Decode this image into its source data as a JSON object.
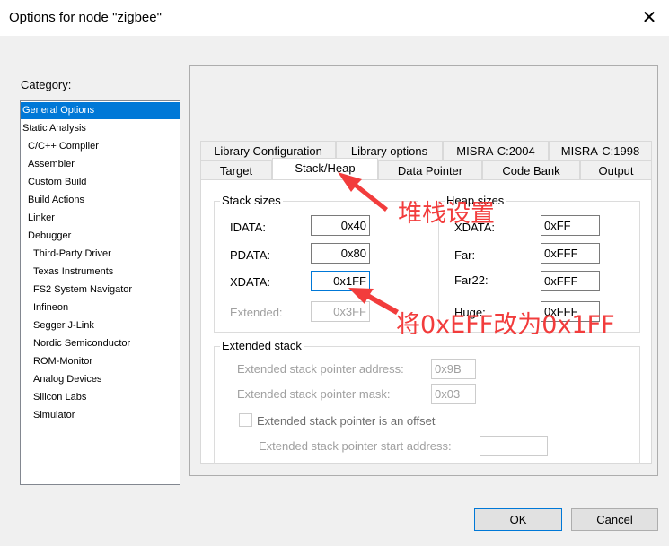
{
  "window": {
    "title": "Options for node \"zigbee\""
  },
  "category": {
    "label": "Category:",
    "items": [
      {
        "label": "General Options",
        "level": 0,
        "selected": true
      },
      {
        "label": "Static Analysis",
        "level": 0
      },
      {
        "label": "C/C++ Compiler",
        "level": 1
      },
      {
        "label": "Assembler",
        "level": 1
      },
      {
        "label": "Custom Build",
        "level": 1
      },
      {
        "label": "Build Actions",
        "level": 1
      },
      {
        "label": "Linker",
        "level": 1
      },
      {
        "label": "Debugger",
        "level": 1
      },
      {
        "label": "Third-Party Driver",
        "level": 2
      },
      {
        "label": "Texas Instruments",
        "level": 2
      },
      {
        "label": "FS2 System Navigator",
        "level": 2
      },
      {
        "label": "Infineon",
        "level": 2
      },
      {
        "label": "Segger J-Link",
        "level": 2
      },
      {
        "label": "Nordic Semiconductor",
        "level": 2
      },
      {
        "label": "ROM-Monitor",
        "level": 2
      },
      {
        "label": "Analog Devices",
        "level": 2
      },
      {
        "label": "Silicon Labs",
        "level": 2
      },
      {
        "label": "Simulator",
        "level": 2
      }
    ]
  },
  "tabs": {
    "row1": [
      "Library Configuration",
      "Library options",
      "MISRA-C:2004",
      "MISRA-C:1998"
    ],
    "row2": [
      "Target",
      "Stack/Heap",
      "Data Pointer",
      "Code Bank",
      "Output"
    ],
    "selected": "Stack/Heap"
  },
  "stack": {
    "title": "Stack sizes",
    "idata_label": "IDATA:",
    "idata": "0x40",
    "pdata_label": "PDATA:",
    "pdata": "0x80",
    "xdata_label": "XDATA:",
    "xdata": "0x1FF",
    "extended_label": "Extended:",
    "extended": "0x3FF"
  },
  "heap": {
    "title": "Heap sizes",
    "xdata_label": "XDATA:",
    "xdata": "0xFF",
    "far_label": "Far:",
    "far": "0xFFF",
    "far22_label": "Far22:",
    "far22": "0xFFF",
    "huge_label": "Huge:",
    "huge": "0xFFF"
  },
  "extended_stack": {
    "title": "Extended stack",
    "addr_label": "Extended stack pointer address:",
    "addr": "0x9B",
    "mask_label": "Extended stack pointer mask:",
    "mask": "0x03",
    "offset_label": "Extended stack pointer is an offset",
    "offset_checked": false,
    "start_label": "Extended stack pointer start address:",
    "start": ""
  },
  "buttons": {
    "ok": "OK",
    "cancel": "Cancel"
  },
  "annotations": {
    "a1": "堆栈设置",
    "a2": "将0xEFF改为0x1FF",
    "color": "#f23c3c"
  },
  "colors": {
    "accent": "#0078d7"
  }
}
